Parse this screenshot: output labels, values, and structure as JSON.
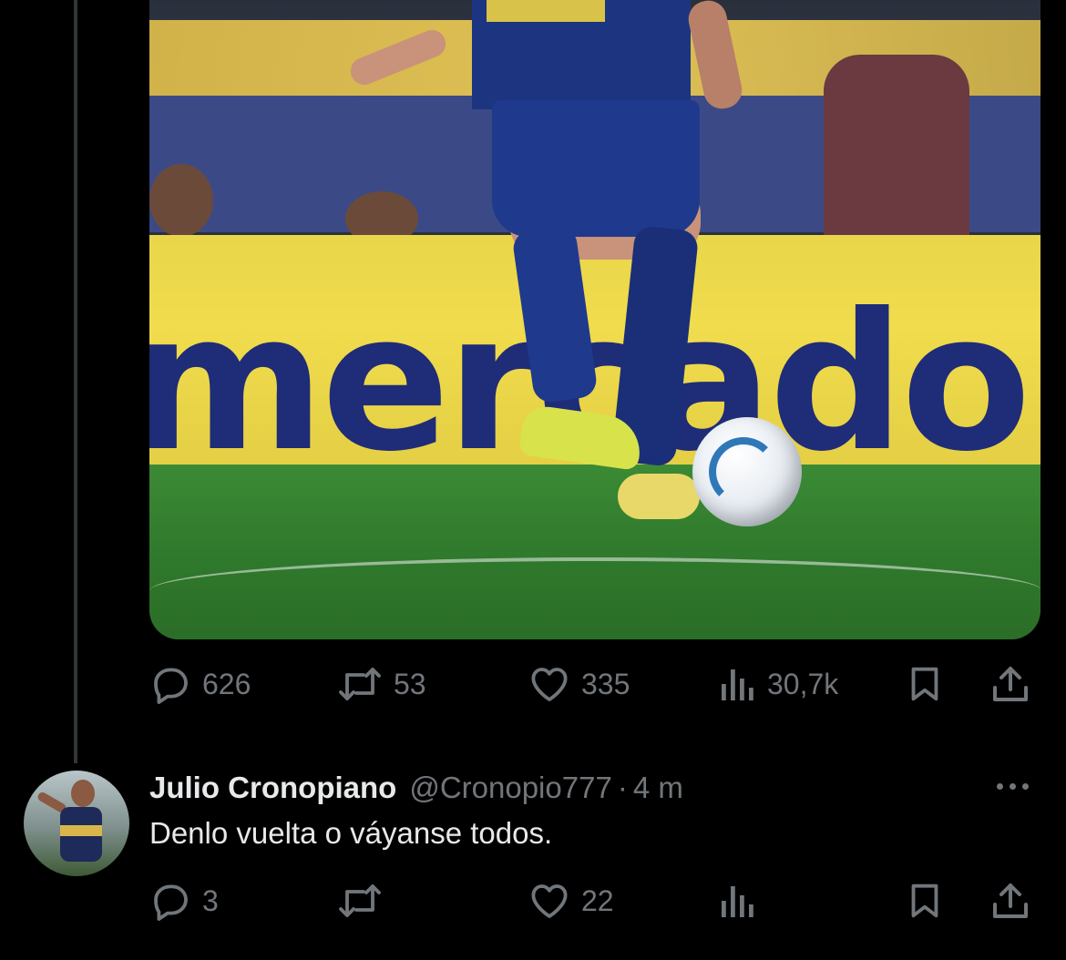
{
  "media": {
    "image_text": "mercado l"
  },
  "tweet_actions": {
    "replies": "626",
    "reposts": "53",
    "likes": "335",
    "views": "30,7k"
  },
  "reply": {
    "name": "Julio Cronopiano",
    "handle": "@Cronopio777",
    "separator": "·",
    "time": "4 m",
    "text": "Denlo vuelta o váyanse todos.",
    "actions": {
      "replies": "3",
      "reposts": "",
      "likes": "22",
      "views": ""
    }
  },
  "colors": {
    "background": "#000000",
    "text_primary": "#e7e9ea",
    "text_secondary": "#71767b",
    "thread_line": "#333639"
  },
  "icons": [
    "reply-icon",
    "repost-icon",
    "like-icon",
    "views-icon",
    "bookmark-icon",
    "share-icon",
    "more-icon"
  ]
}
